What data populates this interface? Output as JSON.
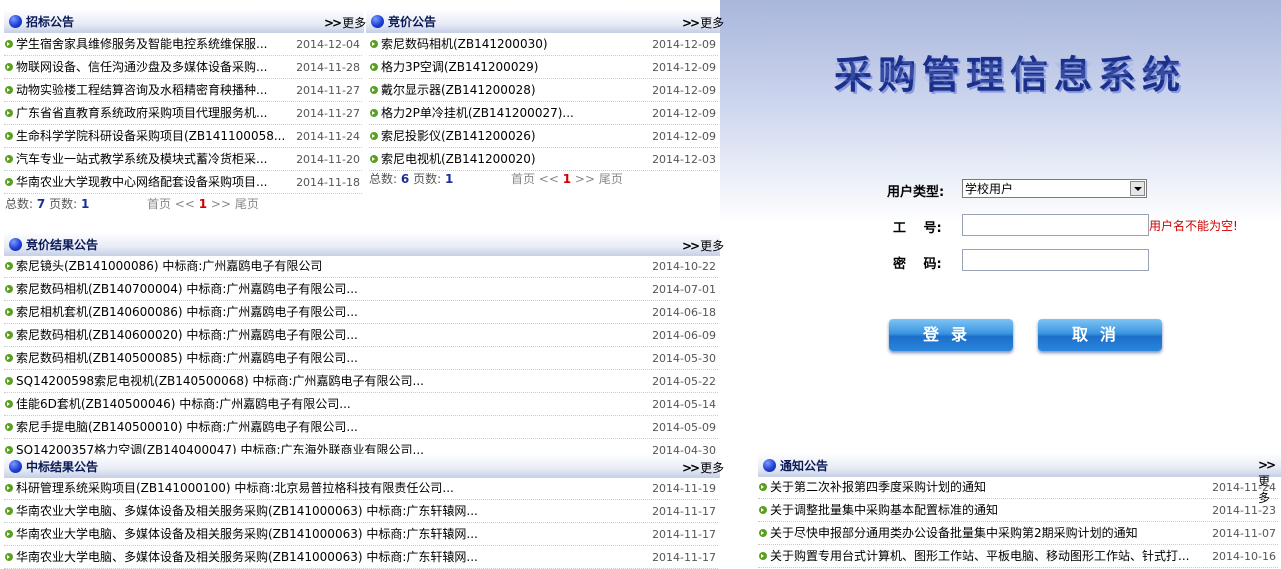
{
  "bid_notices": {
    "title": "招标公告",
    "more": "更多",
    "items": [
      {
        "text": "学生宿舍家具维修服务及智能电控系统维保服...",
        "date": "2014-12-04"
      },
      {
        "text": "物联网设备、信任沟通沙盘及多媒体设备采购...",
        "date": "2014-11-28"
      },
      {
        "text": "动物实验楼工程结算咨询及水稻精密育秧播种...",
        "date": "2014-11-27"
      },
      {
        "text": "广东省省直教育系统政府采购项目代理服务机...",
        "date": "2014-11-27"
      },
      {
        "text": "生命科学学院科研设备采购项目(ZB141100058...",
        "date": "2014-11-24"
      },
      {
        "text": "汽车专业一站式教学系统及模块式蓄冷货柜采...",
        "date": "2014-11-20"
      },
      {
        "text": "华南农业大学现教中心网络配套设备采购项目...",
        "date": "2014-11-18"
      }
    ],
    "pager": {
      "total_label": "总数:",
      "total": "7",
      "pages_label": "页数:",
      "pages": "1",
      "first": "首页",
      "prev": "<<",
      "current": "1",
      "next": ">>",
      "last": "尾页"
    }
  },
  "price_notices": {
    "title": "竞价公告",
    "more": "更多",
    "items": [
      {
        "text": "索尼数码相机(ZB141200030)",
        "date": "2014-12-09"
      },
      {
        "text": "格力3P空调(ZB141200029)",
        "date": "2014-12-09"
      },
      {
        "text": "戴尔显示器(ZB141200028)",
        "date": "2014-12-09"
      },
      {
        "text": "格力2P单冷挂机(ZB141200027)...",
        "date": "2014-12-09"
      },
      {
        "text": "索尼投影仪(ZB141200026)",
        "date": "2014-12-09"
      },
      {
        "text": "索尼电视机(ZB141200020)",
        "date": "2014-12-03"
      }
    ],
    "pager": {
      "total_label": "总数:",
      "total": "6",
      "pages_label": "页数:",
      "pages": "1",
      "first": "首页",
      "prev": "<<",
      "current": "1",
      "next": ">>",
      "last": "尾页"
    }
  },
  "price_results": {
    "title": "竞价结果公告",
    "more": "更多",
    "items": [
      {
        "text": "索尼镜头(ZB141000086) 中标商:广州嘉鸥电子有限公司",
        "date": "2014-10-22"
      },
      {
        "text": "索尼数码相机(ZB140700004) 中标商:广州嘉鸥电子有限公司...",
        "date": "2014-07-01"
      },
      {
        "text": "索尼相机套机(ZB140600086) 中标商:广州嘉鸥电子有限公司...",
        "date": "2014-06-18"
      },
      {
        "text": "索尼数码相机(ZB140600020) 中标商:广州嘉鸥电子有限公司...",
        "date": "2014-06-09"
      },
      {
        "text": "索尼数码相机(ZB140500085) 中标商:广州嘉鸥电子有限公司...",
        "date": "2014-05-30"
      },
      {
        "text": "SQ14200598索尼电视机(ZB140500068) 中标商:广州嘉鸥电子有限公司...",
        "date": "2014-05-22"
      },
      {
        "text": "佳能6D套机(ZB140500046) 中标商:广州嘉鸥电子有限公司...",
        "date": "2014-05-14"
      },
      {
        "text": "索尼手提电脑(ZB140500010) 中标商:广州嘉鸥电子有限公司...",
        "date": "2014-05-09"
      },
      {
        "text": "SQ14200357格力空调(ZB140400047) 中标商:广东海外联商业有限公司...",
        "date": "2014-04-30"
      }
    ]
  },
  "bid_results": {
    "title": "中标结果公告",
    "more": "更多",
    "items": [
      {
        "text": "科研管理系统采购项目(ZB141000100) 中标商:北京易普拉格科技有限责任公司...",
        "date": "2014-11-19"
      },
      {
        "text": "华南农业大学电脑、多媒体设备及相关服务采购(ZB141000063) 中标商:广东轩辕网...",
        "date": "2014-11-17"
      },
      {
        "text": "华南农业大学电脑、多媒体设备及相关服务采购(ZB141000063) 中标商:广东轩辕网...",
        "date": "2014-11-17"
      },
      {
        "text": "华南农业大学电脑、多媒体设备及相关服务采购(ZB141000063) 中标商:广东轩辕网...",
        "date": "2014-11-17"
      }
    ]
  },
  "notices": {
    "title": "通知公告",
    "more": "更多",
    "items": [
      {
        "text": "关于第二次补报第四季度采购计划的通知",
        "date": "2014-11-24"
      },
      {
        "text": "关于调整批量集中采购基本配置标准的通知",
        "date": "2014-11-23"
      },
      {
        "text": "关于尽快申报部分通用类办公设备批量集中采购第2期采购计划的通知",
        "date": "2014-11-07"
      },
      {
        "text": "关于购置专用台式计算机、图形工作站、平板电脑、移动图形工作站、针式打...",
        "date": "2014-10-16"
      }
    ]
  },
  "login": {
    "system_title": "采购管理信息系统",
    "user_type_label": "用户类型:",
    "user_type_value": "学校用户",
    "id_label": "工　 号:",
    "id_value": "",
    "id_error": "用户名不能为空!",
    "password_label": "密　 码:",
    "password_value": "",
    "login_button": "登录",
    "cancel_button": "取消"
  }
}
